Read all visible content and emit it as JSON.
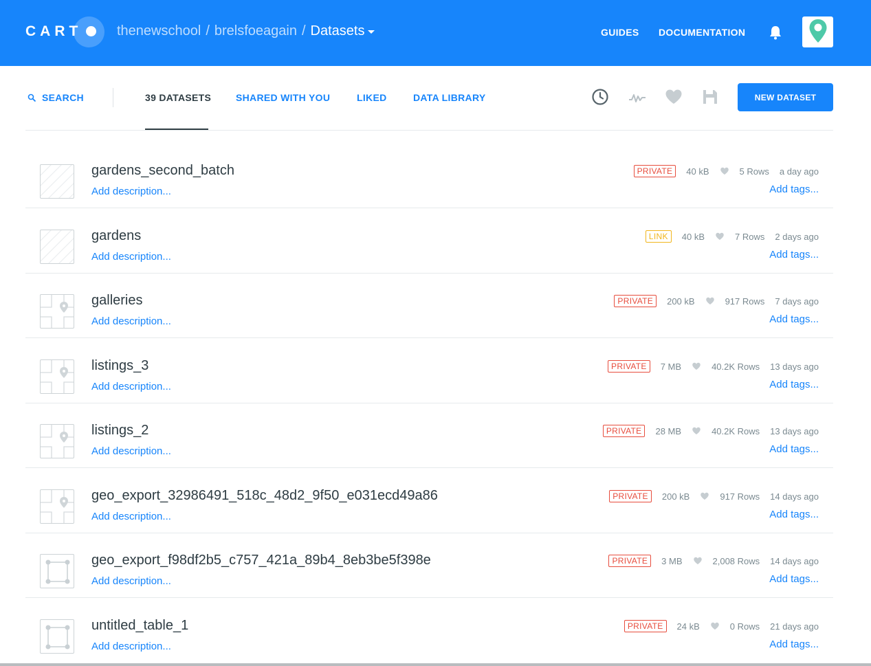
{
  "header": {
    "logo_text": "CART",
    "breadcrumb": [
      "thenewschool",
      "brelsfoeagain",
      "Datasets"
    ],
    "nav": [
      "GUIDES",
      "DOCUMENTATION"
    ],
    "bg_color": "#1785fb",
    "icons": [
      "bell-icon",
      "map-pin-avatar-icon"
    ]
  },
  "filters": {
    "search_label": "SEARCH",
    "tabs": [
      "39 DATASETS",
      "SHARED WITH YOU",
      "LIKED",
      "DATA LIBRARY"
    ],
    "active_tab": "39 DATASETS",
    "tool_icons": [
      "clock-icon",
      "activity-icon",
      "heart-icon",
      "save-icon"
    ],
    "new_button": "NEW DATASET"
  },
  "datasets": [
    {
      "name": "gardens_second_batch",
      "description": "Add description...",
      "privacy": "PRIVATE",
      "size": "40 kB",
      "rows": "5 Rows",
      "updated": "a day ago",
      "tags": "Add tags...",
      "thumb": "hatched"
    },
    {
      "name": "gardens",
      "description": "Add description...",
      "privacy": "LINK",
      "size": "40 kB",
      "rows": "7 Rows",
      "updated": "2 days ago",
      "tags": "Add tags...",
      "thumb": "hatched"
    },
    {
      "name": "galleries",
      "description": "Add description...",
      "privacy": "PRIVATE",
      "size": "200 kB",
      "rows": "917 Rows",
      "updated": "7 days ago",
      "tags": "Add tags...",
      "thumb": "point"
    },
    {
      "name": "listings_3",
      "description": "Add description...",
      "privacy": "PRIVATE",
      "size": "7 MB",
      "rows": "40.2K Rows",
      "updated": "13 days ago",
      "tags": "Add tags...",
      "thumb": "point"
    },
    {
      "name": "listings_2",
      "description": "Add description...",
      "privacy": "PRIVATE",
      "size": "28 MB",
      "rows": "40.2K Rows",
      "updated": "13 days ago",
      "tags": "Add tags...",
      "thumb": "point"
    },
    {
      "name": "geo_export_32986491_518c_48d2_9f50_e031ecd49a86",
      "description": "Add description...",
      "privacy": "PRIVATE",
      "size": "200 kB",
      "rows": "917 Rows",
      "updated": "14 days ago",
      "tags": "Add tags...",
      "thumb": "point"
    },
    {
      "name": "geo_export_f98df2b5_c757_421a_89b4_8eb3be5f398e",
      "description": "Add description...",
      "privacy": "PRIVATE",
      "size": "3 MB",
      "rows": "2,008 Rows",
      "updated": "14 days ago",
      "tags": "Add tags...",
      "thumb": "polygon"
    },
    {
      "name": "untitled_table_1",
      "description": "Add description...",
      "privacy": "PRIVATE",
      "size": "24 kB",
      "rows": "0 Rows",
      "updated": "21 days ago",
      "tags": "Add tags...",
      "thumb": "polygon"
    }
  ]
}
